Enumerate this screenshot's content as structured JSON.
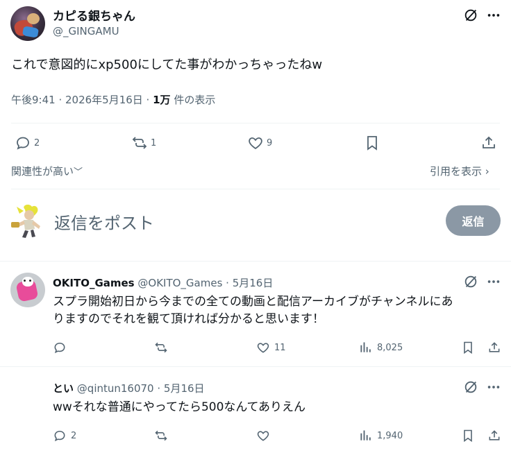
{
  "tweet": {
    "author_name": "カピる銀ちゃん",
    "author_handle": "@_GINGAMU",
    "text": "これで意図的にxp500にしてた事がわかっちゃったねw",
    "time": "午後9:41 · 2026年5月16日 · ",
    "views_count": "1万",
    "views_label": " 件の表示",
    "replies": "2",
    "retweets": "1",
    "likes": "9"
  },
  "sort": {
    "relevance_label": "関連性が高い",
    "quotes_label": "引用を表示"
  },
  "composer": {
    "placeholder": "返信をポスト",
    "reply_button": "返信"
  },
  "replies": [
    {
      "name": "OKITO_Games",
      "handle": "@OKITO_Games · 5月16日",
      "text_line1": "スプラ開始初日から今までの全ての動画と配信アーカイブがチャンネルにあ",
      "text_line2": "りますのでそれを観て頂ければ分かると思います！",
      "replies": "",
      "retweets": "",
      "likes": "11",
      "views": "8,025"
    },
    {
      "name": "とい",
      "handle": "@qintun16070 · 5月16日",
      "text_line1": "wwそれな普通にやってたら500なんてありえん",
      "replies": "2",
      "retweets": "",
      "likes": "",
      "views": "1,940"
    }
  ],
  "icons": {
    "reply": "reply-icon",
    "retweet": "retweet-icon",
    "like": "heart-icon",
    "bookmark": "bookmark-icon",
    "share": "share-icon",
    "views": "views-icon",
    "grok": "grok-icon",
    "more": "more-icon"
  },
  "colors": {
    "text": "#0f1419",
    "secondary": "#536471",
    "button_disabled": "#8b98a5",
    "divider": "#eff3f4"
  }
}
